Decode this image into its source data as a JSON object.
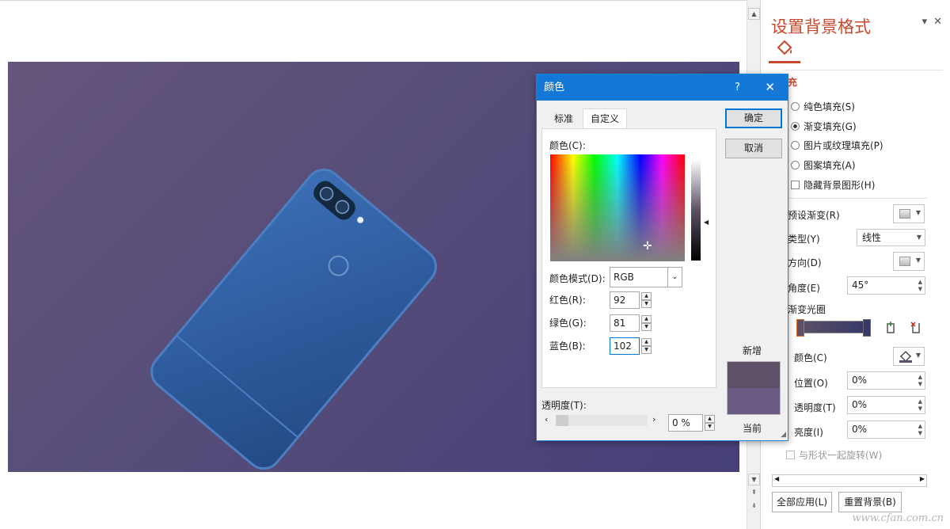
{
  "pane": {
    "title": "设置背景格式",
    "section_fill": "充",
    "fill_options": [
      "纯色填充(S)",
      "渐变填充(G)",
      "图片或纹理填充(P)",
      "图案填充(A)",
      "隐藏背景图形(H)"
    ],
    "preset_label": "预设渐变(R)",
    "type_label": "类型(Y)",
    "type_value": "线性",
    "direction_label": "方向(D)",
    "angle_label": "角度(E)",
    "angle_value": "45°",
    "stops_label": "渐变光圈",
    "color_label": "颜色(C)",
    "position_label": "位置(O)",
    "position_value": "0%",
    "transparency_label": "透明度(T)",
    "transparency_value": "0%",
    "brightness_label": "亮度(I)",
    "brightness_value": "0%",
    "rotate_label": "与形状一起旋转(W)",
    "apply_all": "全部应用(L)",
    "reset": "重置背景(B)"
  },
  "dialog": {
    "title": "颜色",
    "help": "?",
    "close": "✕",
    "tab_standard": "标准",
    "tab_custom": "自定义",
    "colors_label": "颜色(C):",
    "mode_label": "颜色模式(D):",
    "mode_value": "RGB",
    "red_label": "红色(R):",
    "red_value": "92",
    "green_label": "绿色(G):",
    "green_value": "81",
    "blue_label": "蓝色(B):",
    "blue_value": "102",
    "ok": "确定",
    "cancel": "取消",
    "new_label": "新增",
    "current_label": "当前",
    "transparency_label": "透明度(T):",
    "transparency_value": "0 %"
  },
  "colors": {
    "new_color": "#5c5166",
    "current_color": "#6b5b84",
    "accent": "#c8482c",
    "titlebar": "#1479d6"
  },
  "watermark": "www.cfan.com.cn"
}
